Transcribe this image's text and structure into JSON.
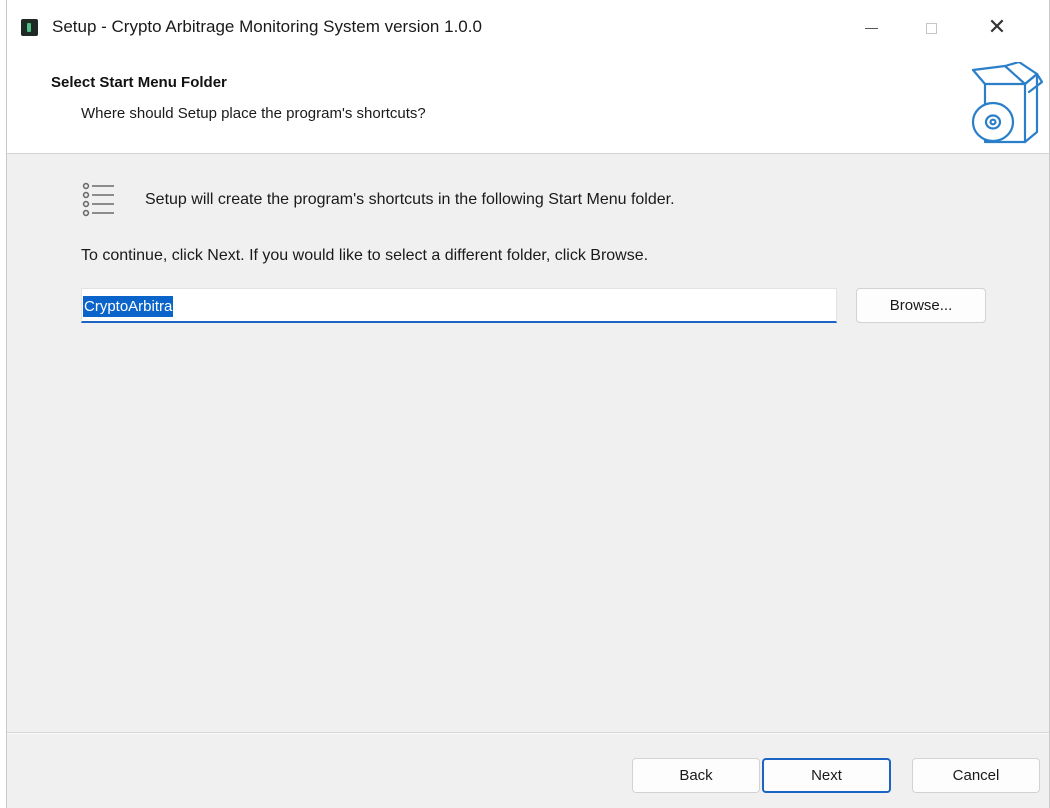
{
  "window": {
    "title": "Setup - Crypto Arbitrage Monitoring System version 1.0.0",
    "icon": "app-icon",
    "controls": {
      "minimize_icon": "minimize-icon",
      "maximize_icon": "maximize-icon",
      "close_glyph": "✕"
    }
  },
  "header": {
    "title": "Select Start Menu Folder",
    "subtitle": "Where should Setup place the program's shortcuts?",
    "image_icon": "wizard-box-disc-icon"
  },
  "body": {
    "info_icon": "folder-list-icon",
    "info_text": "Setup will create the program's shortcuts in the following Start Menu folder.",
    "continue_text": "To continue, click Next. If you would like to select a different folder, click Browse.",
    "folder_input": {
      "value": "CryptoArbitra",
      "selected": true
    },
    "browse_label": "Browse..."
  },
  "footer": {
    "back_label": "Back",
    "next_label": "Next",
    "cancel_label": "Cancel"
  },
  "colors": {
    "accent": "#1c64c4",
    "selection": "#0a64c9",
    "window_bg": "#f0f0f0",
    "header_bg": "#ffffff"
  }
}
